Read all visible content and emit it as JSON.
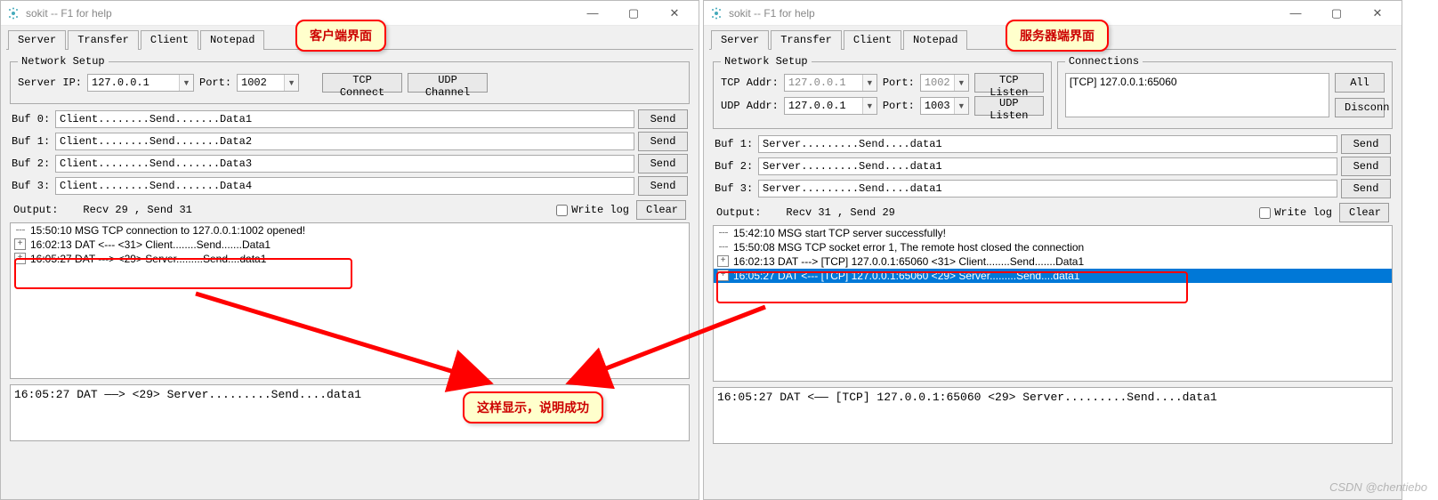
{
  "leftPane": {
    "title": "sokit -- F1 for help",
    "callout": "客户端界面",
    "tabs": [
      "Server",
      "Transfer",
      "Client",
      "Notepad"
    ],
    "activeTab": 2,
    "networkSetup": {
      "legend": "Network Setup",
      "serverIpLabel": "Server IP:",
      "serverIp": "127.0.0.1",
      "portLabel": "Port:",
      "port": "1002",
      "tcpConnect": "TCP Connect",
      "udpChannel": "UDP Channel"
    },
    "buffers": [
      {
        "label": "Buf 0:",
        "value": "Client........Send.......Data1",
        "send": "Send"
      },
      {
        "label": "Buf 1:",
        "value": "Client........Send.......Data2",
        "send": "Send"
      },
      {
        "label": "Buf 2:",
        "value": "Client........Send.......Data3",
        "send": "Send"
      },
      {
        "label": "Buf 3:",
        "value": "Client........Send.......Data4",
        "send": "Send"
      }
    ],
    "output": {
      "label": "Output:",
      "info": "Recv 29 , Send 31",
      "writeLog": "Write log",
      "clear": "Clear"
    },
    "log": [
      {
        "text": "15:50:10 MSG TCP connection to 127.0.0.1:1002 opened!",
        "style": "dashed"
      },
      {
        "text": "16:02:13 DAT <--- <31> Client........Send.......Data1",
        "style": "tree"
      },
      {
        "text": "16:05:27 DAT ---> <29> Server.........Send....data1",
        "style": "tree"
      }
    ],
    "bottom": "16:05:27 DAT ——> <29> Server.........Send....data1"
  },
  "rightPane": {
    "title": "sokit -- F1 for help",
    "callout": "服务器端界面",
    "tabs": [
      "Server",
      "Transfer",
      "Client",
      "Notepad"
    ],
    "activeTab": 0,
    "networkSetup": {
      "legend": "Network Setup",
      "tcpAddrLabel": "TCP Addr:",
      "tcpAddr": "127.0.0.1",
      "tcpPortLabel": "Port:",
      "tcpPort": "1002",
      "tcpListen": "TCP Listen",
      "udpAddrLabel": "UDP Addr:",
      "udpAddr": "127.0.0.1",
      "udpPortLabel": "Port:",
      "udpPort": "1003",
      "udpListen": "UDP Listen"
    },
    "connections": {
      "legend": "Connections",
      "item": "[TCP] 127.0.0.1:65060",
      "all": "All",
      "disconn": "Disconn"
    },
    "buffers": [
      {
        "label": "Buf 1:",
        "value": "Server.........Send....data1",
        "send": "Send"
      },
      {
        "label": "Buf 2:",
        "value": "Server.........Send....data1",
        "send": "Send"
      },
      {
        "label": "Buf 3:",
        "value": "Server.........Send....data1",
        "send": "Send"
      }
    ],
    "output": {
      "label": "Output:",
      "info": "Recv 31 , Send 29",
      "writeLog": "Write log",
      "clear": "Clear"
    },
    "log": [
      {
        "text": "15:42:10 MSG start TCP server successfully!",
        "style": "dashed"
      },
      {
        "text": "15:50:08 MSG TCP socket error 1, The remote host closed the connection",
        "style": "dashed"
      },
      {
        "text": "16:02:13 DAT ---> [TCP] 127.0.0.1:65060 <31> Client........Send.......Data1",
        "style": "tree"
      },
      {
        "text": "16:05:27 DAT <--- [TCP] 127.0.0.1:65060 <29> Server.........Send....data1",
        "style": "tree selected"
      }
    ],
    "bottom": "16:05:27 DAT <—— [TCP] 127.0.0.1:65060 <29> Server.........Send....data1"
  },
  "centerCallout": "这样显示，说明成功",
  "watermark": "CSDN @chentiebo"
}
